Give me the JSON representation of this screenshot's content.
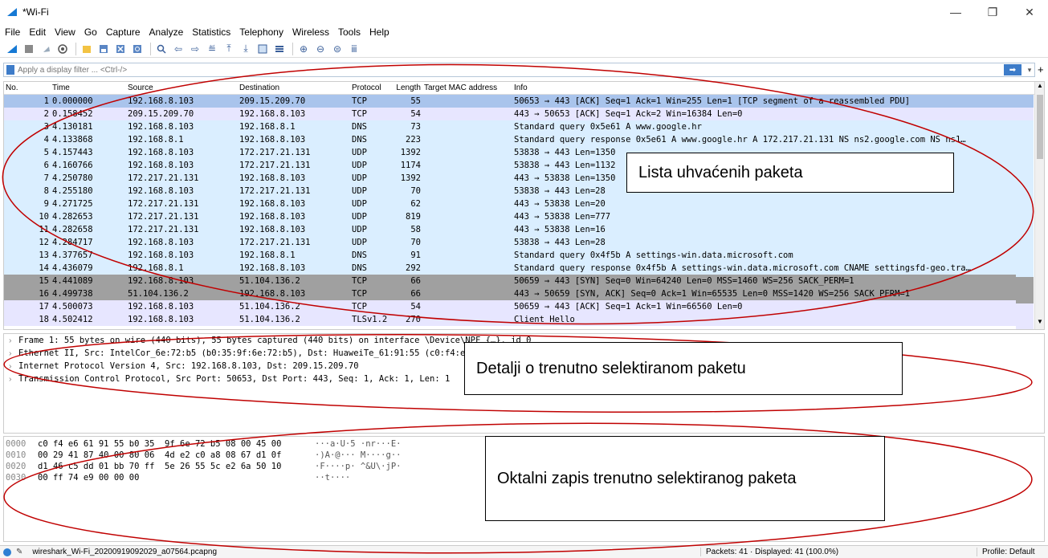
{
  "window": {
    "title": "*Wi-Fi",
    "minimize": "—",
    "maximize": "❐",
    "close": "✕"
  },
  "menu": [
    "File",
    "Edit",
    "View",
    "Go",
    "Capture",
    "Analyze",
    "Statistics",
    "Telephony",
    "Wireless",
    "Tools",
    "Help"
  ],
  "filter": {
    "placeholder": "Apply a display filter ... <Ctrl-/>",
    "apply_icon": "arrow-right-icon",
    "plus": "+"
  },
  "columns": {
    "no": "No.",
    "time": "Time",
    "source": "Source",
    "destination": "Destination",
    "protocol": "Protocol",
    "length": "Length",
    "mac": "Target MAC address",
    "info": "Info"
  },
  "packets": [
    {
      "no": "1",
      "time": "0.000000",
      "src": "192.168.8.103",
      "dst": "209.15.209.70",
      "proto": "TCP",
      "len": "55",
      "info": "50653 → 443 [ACK] Seq=1 Ack=1 Win=255 Len=1 [TCP segment of a reassembled PDU]",
      "bg": "#a9c4ec"
    },
    {
      "no": "2",
      "time": "0.158452",
      "src": "209.15.209.70",
      "dst": "192.168.8.103",
      "proto": "TCP",
      "len": "54",
      "info": "443 → 50653 [ACK] Seq=1 Ack=2 Win=16384 Len=0",
      "bg": "#e7e6ff"
    },
    {
      "no": "3",
      "time": "4.130181",
      "src": "192.168.8.103",
      "dst": "192.168.8.1",
      "proto": "DNS",
      "len": "73",
      "info": "Standard query 0x5e61 A www.google.hr",
      "bg": "#daeeff"
    },
    {
      "no": "4",
      "time": "4.133868",
      "src": "192.168.8.1",
      "dst": "192.168.8.103",
      "proto": "DNS",
      "len": "223",
      "info": "Standard query response 0x5e61 A www.google.hr A 172.217.21.131 NS ns2.google.com NS ns1…",
      "bg": "#daeeff"
    },
    {
      "no": "5",
      "time": "4.157443",
      "src": "192.168.8.103",
      "dst": "172.217.21.131",
      "proto": "UDP",
      "len": "1392",
      "info": "53838 → 443 Len=1350",
      "bg": "#daeeff"
    },
    {
      "no": "6",
      "time": "4.160766",
      "src": "192.168.8.103",
      "dst": "172.217.21.131",
      "proto": "UDP",
      "len": "1174",
      "info": "53838 → 443 Len=1132",
      "bg": "#daeeff"
    },
    {
      "no": "7",
      "time": "4.250780",
      "src": "172.217.21.131",
      "dst": "192.168.8.103",
      "proto": "UDP",
      "len": "1392",
      "info": "443 → 53838 Len=1350",
      "bg": "#daeeff"
    },
    {
      "no": "8",
      "time": "4.255180",
      "src": "192.168.8.103",
      "dst": "172.217.21.131",
      "proto": "UDP",
      "len": "70",
      "info": "53838 → 443 Len=28",
      "bg": "#daeeff"
    },
    {
      "no": "9",
      "time": "4.271725",
      "src": "172.217.21.131",
      "dst": "192.168.8.103",
      "proto": "UDP",
      "len": "62",
      "info": "443 → 53838 Len=20",
      "bg": "#daeeff"
    },
    {
      "no": "10",
      "time": "4.282653",
      "src": "172.217.21.131",
      "dst": "192.168.8.103",
      "proto": "UDP",
      "len": "819",
      "info": "443 → 53838 Len=777",
      "bg": "#daeeff"
    },
    {
      "no": "11",
      "time": "4.282658",
      "src": "172.217.21.131",
      "dst": "192.168.8.103",
      "proto": "UDP",
      "len": "58",
      "info": "443 → 53838 Len=16",
      "bg": "#daeeff"
    },
    {
      "no": "12",
      "time": "4.284717",
      "src": "192.168.8.103",
      "dst": "172.217.21.131",
      "proto": "UDP",
      "len": "70",
      "info": "53838 → 443 Len=28",
      "bg": "#daeeff"
    },
    {
      "no": "13",
      "time": "4.377657",
      "src": "192.168.8.103",
      "dst": "192.168.8.1",
      "proto": "DNS",
      "len": "91",
      "info": "Standard query 0x4f5b A settings-win.data.microsoft.com",
      "bg": "#daeeff"
    },
    {
      "no": "14",
      "time": "4.436079",
      "src": "192.168.8.1",
      "dst": "192.168.8.103",
      "proto": "DNS",
      "len": "292",
      "info": "Standard query response 0x4f5b A settings-win.data.microsoft.com CNAME settingsfd-geo.tra…",
      "bg": "#daeeff"
    },
    {
      "no": "15",
      "time": "4.441089",
      "src": "192.168.8.103",
      "dst": "51.104.136.2",
      "proto": "TCP",
      "len": "66",
      "info": "50659 → 443 [SYN] Seq=0 Win=64240 Len=0 MSS=1460 WS=256 SACK_PERM=1",
      "bg": "#a0a0a0"
    },
    {
      "no": "16",
      "time": "4.499738",
      "src": "51.104.136.2",
      "dst": "192.168.8.103",
      "proto": "TCP",
      "len": "66",
      "info": "443 → 50659 [SYN, ACK] Seq=0 Ack=1 Win=65535 Len=0 MSS=1420 WS=256 SACK_PERM=1",
      "bg": "#a0a0a0"
    },
    {
      "no": "17",
      "time": "4.500073",
      "src": "192.168.8.103",
      "dst": "51.104.136.2",
      "proto": "TCP",
      "len": "54",
      "info": "50659 → 443 [ACK] Seq=1 Ack=1 Win=66560 Len=0",
      "bg": "#e7e6ff"
    },
    {
      "no": "18",
      "time": "4.502412",
      "src": "192.168.8.103",
      "dst": "51.104.136.2",
      "proto": "TLSv1.2",
      "len": "270",
      "info": "Client Hello",
      "bg": "#e7e6ff"
    }
  ],
  "details": [
    "Frame 1: 55 bytes on wire (440 bits), 55 bytes captured (440 bits) on interface \\Device\\NPF_{…}, id 0",
    "Ethernet II, Src: IntelCor_6e:72:b5 (b0:35:9f:6e:72:b5), Dst: HuaweiTe_61:91:55 (c0:f4:e6:61:91:55)",
    "Internet Protocol Version 4, Src: 192.168.8.103, Dst: 209.15.209.70",
    "Transmission Control Protocol, Src Port: 50653, Dst Port: 443, Seq: 1, Ack: 1, Len: 1"
  ],
  "bytes": [
    {
      "off": "0000",
      "hex": "c0 f4 e6 61 91 55 b0 35  9f 6e 72 b5 08 00 45 00",
      "ascii": "···a·U·5 ·nr···E·"
    },
    {
      "off": "0010",
      "hex": "00 29 41 87 40 00 80 06  4d e2 c0 a8 08 67 d1 0f",
      "ascii": "·)A·@··· M····g··"
    },
    {
      "off": "0020",
      "hex": "d1 46 c5 dd 01 bb 70 ff  5e 26 55 5c e2 6a 50 10",
      "ascii": "·F····p· ^&U\\·jP·"
    },
    {
      "off": "0030",
      "hex": "00 ff 74 e9 00 00 00",
      "ascii": "··t····"
    }
  ],
  "status": {
    "file": "wireshark_Wi-Fi_20200919092029_a07564.pcapng",
    "packets": "Packets: 41 · Displayed: 41 (100.0%)",
    "profile": "Profile: Default"
  },
  "annotations": {
    "list": "Lista uhvaćenih paketa",
    "details": "Detalji o trenutno selektiranom paketu",
    "bytes": "Oktalni zapis trenutno selektiranog paketa"
  },
  "colors": {
    "annotation_ellipse": "#c00000",
    "selected_row": "#a9c4ec",
    "accent": "#3d7cc9"
  }
}
